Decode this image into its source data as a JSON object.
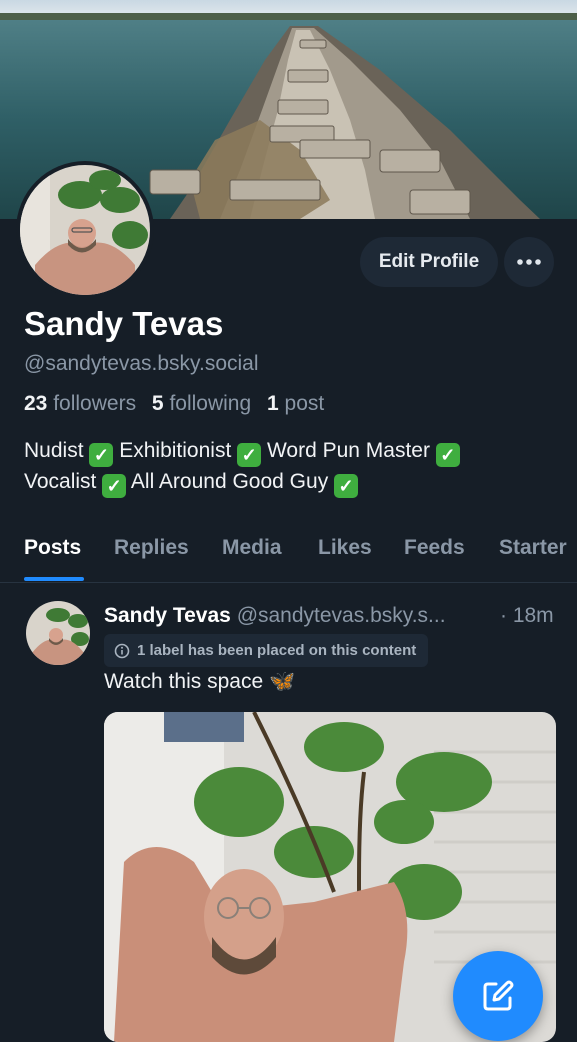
{
  "profile": {
    "display_name": "Sandy Tevas",
    "handle": "@sandytevas.bsky.social",
    "followers_count": "23",
    "followers_label": "followers",
    "following_count": "5",
    "following_label": "following",
    "posts_count": "1",
    "posts_label": "post",
    "bio": {
      "line1": [
        {
          "text": "Nudist"
        },
        {
          "text": "Exhibitionist"
        },
        {
          "text": "Word Pun Master"
        }
      ],
      "line2": [
        {
          "text": "Vocalist"
        },
        {
          "text": "All Around Good Guy"
        }
      ],
      "check_glyph": "✓"
    }
  },
  "actions": {
    "edit_profile": "Edit Profile",
    "more_icon": "ellipsis-icon"
  },
  "tabs": [
    {
      "label": "Posts",
      "active": true
    },
    {
      "label": "Replies",
      "active": false
    },
    {
      "label": "Media",
      "active": false
    },
    {
      "label": "Likes",
      "active": false
    },
    {
      "label": "Feeds",
      "active": false
    },
    {
      "label": "Starter",
      "active": false
    }
  ],
  "post": {
    "author_name": "Sandy Tevas",
    "author_handle": "@sandytevas.bsky.s...",
    "time": "· 18m",
    "label_notice": "1 label has been placed on this content",
    "text": "Watch this space 🦋"
  },
  "fab": {
    "icon": "compose-icon"
  },
  "colors": {
    "background": "#161e27",
    "accent": "#208bfe",
    "muted_text": "#8a97a6",
    "button_bg": "#1e2936",
    "check_green": "#3fae3f"
  }
}
